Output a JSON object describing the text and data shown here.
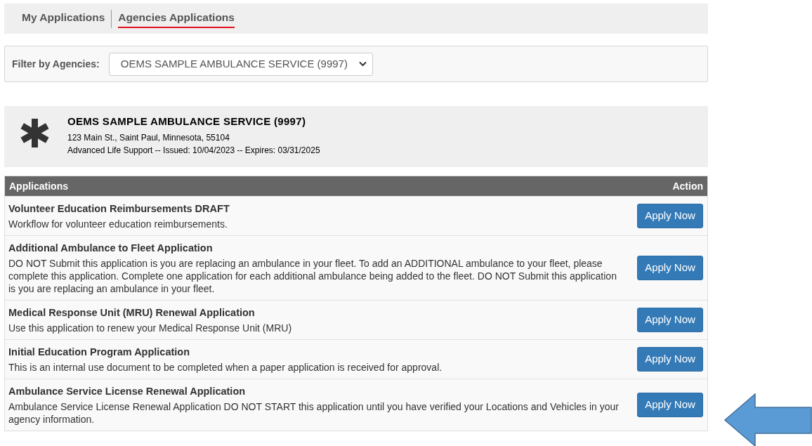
{
  "tabs": [
    {
      "label": "My Applications",
      "selected": false
    },
    {
      "label": "Agencies Applications",
      "selected": true
    }
  ],
  "filter": {
    "label": "Filter by Agencies:",
    "value": "OEMS SAMPLE AMBULANCE SERVICE (9997)"
  },
  "agency": {
    "name": "OEMS SAMPLE AMBULANCE SERVICE (9997)",
    "address": "123 Main St., Saint Paul, Minnesota, 55104",
    "license": "Advanced Life Support -- Issued: 10/04/2023 -- Expires: 03/31/2025"
  },
  "table": {
    "columns": [
      "Applications",
      "Action"
    ],
    "rows": [
      {
        "title": "Volunteer Education Reimbursements DRAFT",
        "description": "Workflow for volunteer education reimbursements.",
        "action": "Apply Now"
      },
      {
        "title": "Additional Ambulance to Fleet Application",
        "description": "DO NOT Submit this application is you are replacing an ambulance in your fleet. To add an ADDITIONAL ambulance to your fleet, please complete this application. Complete one application for each additional ambulance being added to the fleet. DO NOT Submit this application is you are replacing an ambulance in your fleet.",
        "action": "Apply Now"
      },
      {
        "title": "Medical Response Unit (MRU) Renewal Application",
        "description": "Use this application to renew your Medical Response Unit (MRU)",
        "action": "Apply Now"
      },
      {
        "title": "Initial Education Program Application",
        "description": "This is an internal use document to be completed when a paper application is received for approval.",
        "action": "Apply Now"
      },
      {
        "title": "Ambulance Service License Renewal Application",
        "description": "Ambulance Service License Renewal Application DO NOT START this application until you have verified your Locations and Vehicles in your agency information.",
        "action": "Apply Now"
      }
    ]
  }
}
